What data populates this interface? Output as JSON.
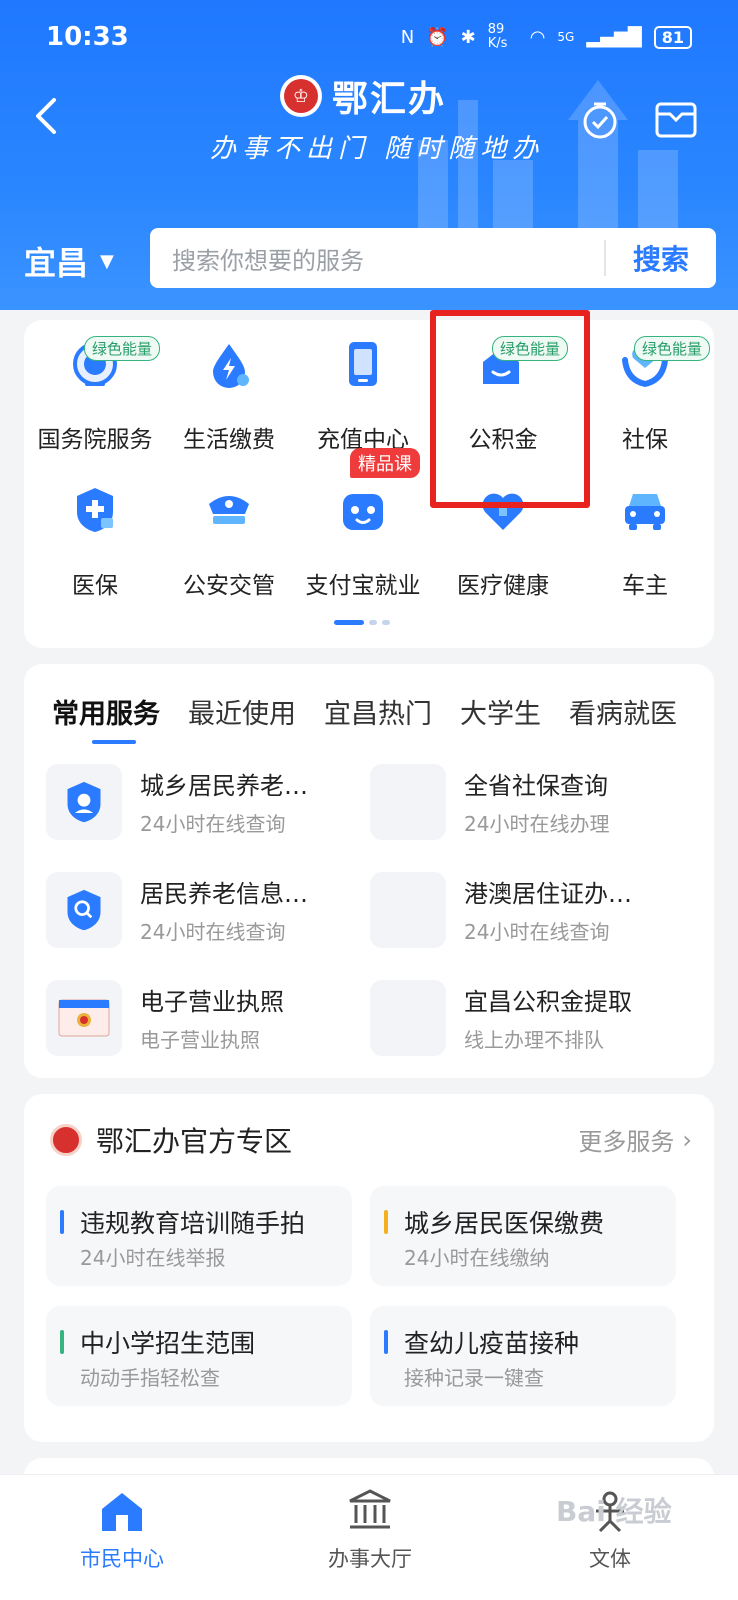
{
  "status": {
    "time": "10:33",
    "net_speed": "89 K/s",
    "network": "5G",
    "battery": "81"
  },
  "header": {
    "brand": "鄂汇办",
    "slogan": "办事不出门 随时随地办",
    "city": "宜昌",
    "search_placeholder": "搜索你想要的服务",
    "search_button": "搜索",
    "brand_color": "#2A7BFF"
  },
  "grid": {
    "items": [
      {
        "label": "国务院服务",
        "icon": "state-council-icon",
        "badge": "绿色能量"
      },
      {
        "label": "生活缴费",
        "icon": "utility-payment-icon",
        "badge": ""
      },
      {
        "label": "充值中心",
        "icon": "phone-recharge-icon",
        "badge": ""
      },
      {
        "label": "公积金",
        "icon": "housing-fund-icon",
        "badge": "绿色能量"
      },
      {
        "label": "社保",
        "icon": "social-security-icon",
        "badge": "绿色能量"
      },
      {
        "label": "医保",
        "icon": "medical-insurance-icon",
        "badge": ""
      },
      {
        "label": "公安交管",
        "icon": "police-traffic-icon",
        "badge": ""
      },
      {
        "label": "支付宝就业",
        "icon": "alipay-jobs-icon",
        "badge": "精品课"
      },
      {
        "label": "医疗健康",
        "icon": "health-icon",
        "badge": ""
      },
      {
        "label": "车主",
        "icon": "car-owner-icon",
        "badge": ""
      }
    ]
  },
  "services": {
    "tabs": [
      "常用服务",
      "最近使用",
      "宜昌热门",
      "大学生",
      "看病就医"
    ],
    "items": [
      {
        "title": "城乡居民养老…",
        "sub": "24小时在线查询"
      },
      {
        "title": "全省社保查询",
        "sub": "24小时在线办理"
      },
      {
        "title": "居民养老信息…",
        "sub": "24小时在线查询"
      },
      {
        "title": "港澳居住证办…",
        "sub": "24小时在线查询"
      },
      {
        "title": "电子营业执照",
        "sub": "电子营业执照"
      },
      {
        "title": "宜昌公积金提取",
        "sub": "线上办理不排队"
      }
    ]
  },
  "zone": {
    "title": "鄂汇办官方专区",
    "more": "更多服务",
    "items": [
      {
        "title": "违规教育培训随手拍",
        "sub": "24小时在线举报",
        "color": "#2A7BFF"
      },
      {
        "title": "城乡居民医保缴费",
        "sub": "24小时在线缴纳",
        "color": "#F2B01E"
      },
      {
        "title": "中小学招生范围",
        "sub": "动动手指轻松查",
        "color": "#36B37E"
      },
      {
        "title": "查幼儿疫苗接种",
        "sub": "接种记录一键查",
        "color": "#2A7BFF"
      }
    ]
  },
  "bottom_nav": [
    {
      "label": "市民中心",
      "icon": "home-icon",
      "active": true
    },
    {
      "label": "办事大厅",
      "icon": "government-hall-icon",
      "active": false
    },
    {
      "label": "文体",
      "icon": "culture-sports-icon",
      "active": false
    }
  ],
  "watermark": "Bai 经验"
}
